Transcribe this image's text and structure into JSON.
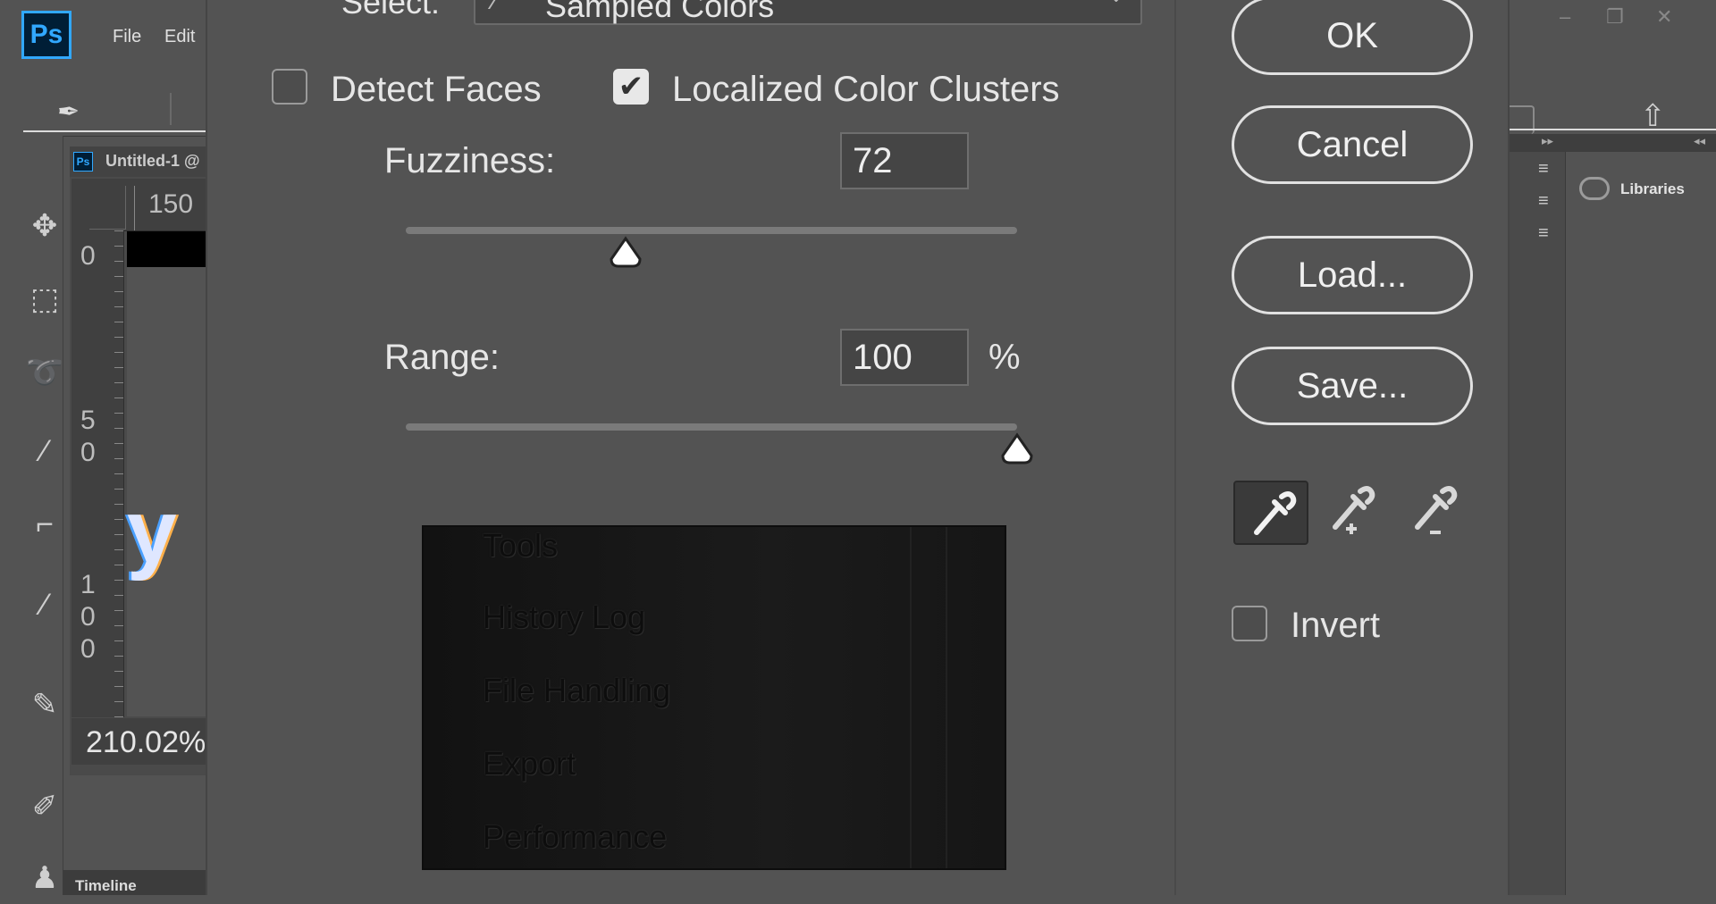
{
  "app": {
    "logo_text": "Ps",
    "menu": [
      "File",
      "Edit"
    ],
    "document_tab_title": "Untitled-1 @",
    "document_tab_icon": "Ps",
    "ruler_top_label": "150",
    "ruler_left_labels": [
      "0",
      "5",
      "0",
      "1",
      "0",
      "0"
    ],
    "zoom": "210.02%",
    "timeline_label": "Timeline",
    "libraries_label": "Libraries",
    "window_controls": [
      "minimize-icon",
      "restore-icon",
      "close-icon"
    ],
    "tool_icons": [
      "move-icon",
      "marquee-icon",
      "lasso-icon",
      "magic-wand-icon",
      "crop-icon",
      "eyedropper-icon",
      "healing-brush-icon",
      "brush-icon",
      "stamp-icon"
    ]
  },
  "dialog": {
    "select_label": "Select:",
    "select_value": "Sampled Colors",
    "detect_faces": {
      "label": "Detect Faces",
      "checked": false
    },
    "localized_clusters": {
      "label": "Localized Color Clusters",
      "checked": true
    },
    "fuzziness": {
      "label": "Fuzziness:",
      "value": "72",
      "fraction": 0.36
    },
    "range": {
      "label": "Range:",
      "value": "100",
      "unit": "%",
      "fraction": 1.0
    },
    "preview_items": [
      "Tools",
      "History Log",
      "File Handling",
      "Export",
      "Performance"
    ],
    "buttons": {
      "ok": "OK",
      "cancel": "Cancel",
      "load": "Load...",
      "save": "Save..."
    },
    "eyedroppers": [
      "eyedropper-icon",
      "eyedropper-plus-icon",
      "eyedropper-minus-icon"
    ],
    "invert": {
      "label": "Invert",
      "checked": false
    },
    "colors": {
      "accent": "#31a8ff",
      "panel": "#535353",
      "field": "#454545"
    }
  }
}
